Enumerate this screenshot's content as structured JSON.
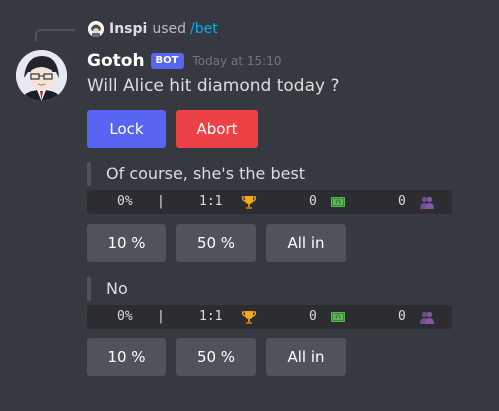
{
  "reply": {
    "user": "Inspi",
    "used_text": "used",
    "command": "/bet"
  },
  "message": {
    "author": "Gotoh",
    "bot_tag": "BOT",
    "timestamp": "Today at 15:10",
    "question": "Will Alice hit diamond today ?"
  },
  "buttons": {
    "lock": "Lock",
    "abort": "Abort"
  },
  "options": [
    {
      "label": "Of course, she's the best",
      "percent": "0%",
      "separator": "|",
      "odds": "1:1",
      "amount": "0",
      "voters": "0",
      "bet_buttons": [
        "10 %",
        "50 %",
        "All in"
      ]
    },
    {
      "label": "No",
      "percent": "0%",
      "separator": "|",
      "odds": "1:1",
      "amount": "0",
      "voters": "0",
      "bet_buttons": [
        "10 %",
        "50 %",
        "All in"
      ]
    }
  ],
  "icons": {
    "odds_icon": "trophy-icon",
    "amount_icon": "money-icon",
    "voters_icon": "people-icon"
  },
  "colors": {
    "background": "#36393f",
    "primary": "#5865f2",
    "danger": "#ed4245",
    "secondary": "#4f545c",
    "link": "#00aff4"
  }
}
